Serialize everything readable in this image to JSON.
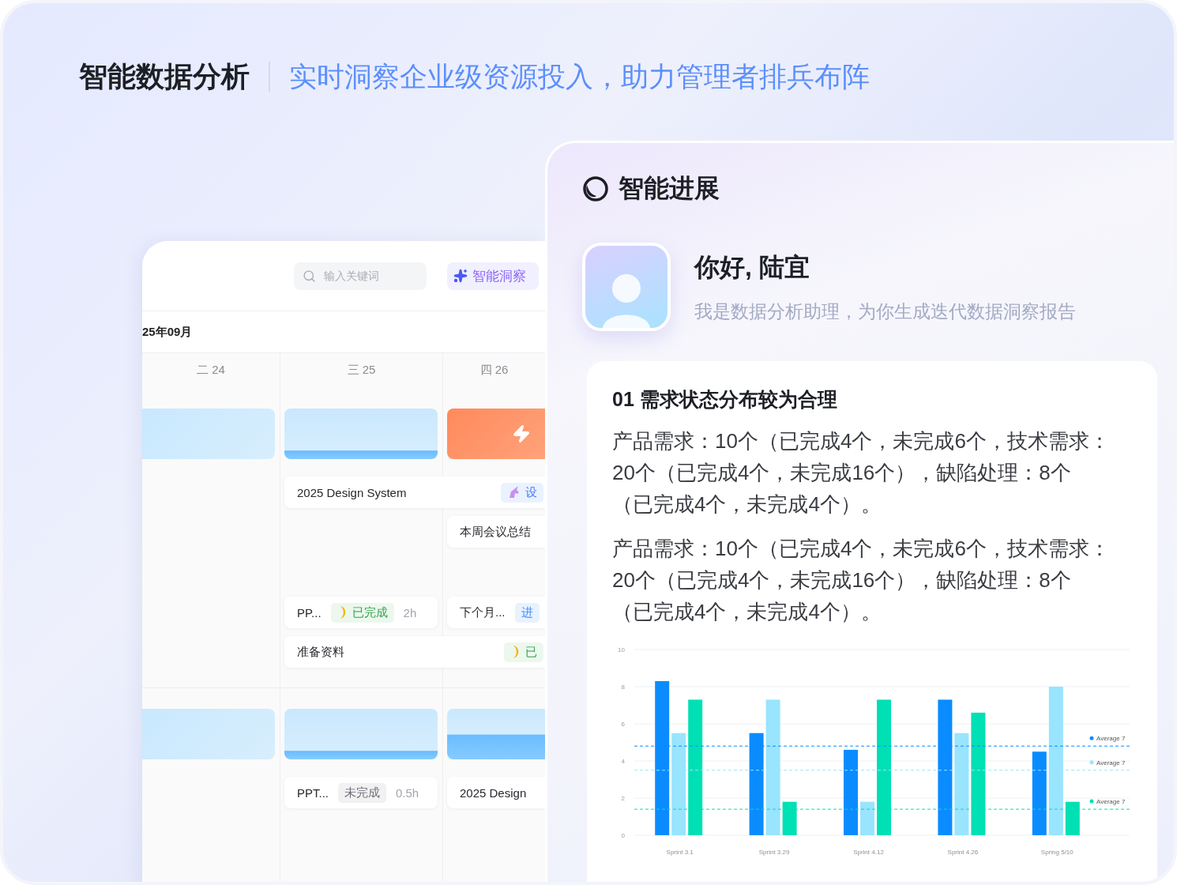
{
  "header": {
    "title": "智能数据分析",
    "subtitle": "实时洞察企业级资源投入，助力管理者排兵布阵"
  },
  "calendar": {
    "search": {
      "placeholder": "输入关键词"
    },
    "insight_button": "智能洞察",
    "month": "25年09月",
    "days": [
      "二 24",
      "三 25",
      "四 26"
    ],
    "weeks": [
      {
        "lanes": [
          [
            {
              "kind": "block"
            },
            {
              "kind": "block"
            },
            {
              "kind": "block"
            }
          ],
          [
            {
              "kind": "empty"
            },
            {
              "kind": "wide_task",
              "title": "2025 Design System",
              "tag": {
                "text": "设",
                "kind": "design"
              }
            }
          ],
          [
            {
              "kind": "empty"
            },
            {
              "kind": "empty"
            },
            {
              "kind": "task",
              "title": "本周会议总结"
            }
          ],
          [
            {
              "kind": "empty"
            },
            {
              "kind": "task",
              "title": "PP...",
              "tag": {
                "text": "已完成",
                "kind": "done"
              },
              "duration": "2h"
            },
            {
              "kind": "task",
              "title": "下个月...",
              "tag": {
                "text": "进",
                "kind": "progress"
              }
            }
          ],
          [
            {
              "kind": "empty"
            },
            {
              "kind": "wide_task",
              "title": "准备资料",
              "tag": {
                "text": "已",
                "kind": "done"
              }
            }
          ]
        ]
      },
      {
        "lanes": [
          [
            {
              "kind": "block"
            },
            {
              "kind": "block"
            },
            {
              "kind": "block"
            }
          ],
          [
            {
              "kind": "empty"
            },
            {
              "kind": "task",
              "title": "PPT...",
              "tag": {
                "text": "未完成",
                "kind": "todo"
              },
              "duration": "0.5h"
            },
            {
              "kind": "task",
              "title": "2025 Design"
            }
          ]
        ]
      }
    ]
  },
  "panel": {
    "title": "智能进展",
    "greeting": "你好, 陆宜",
    "intro": "我是数据分析助理，为你生成迭代数据洞察报告",
    "report": {
      "heading": "01 需求状态分布较为合理",
      "paragraphs": [
        "产品需求：10个（已完成4个，未完成6个，技术需求：20个（已完成4个，未完成16个），缺陷处理：8个（已完成4个，未完成4个）。",
        "产品需求：10个（已完成4个，未完成6个，技术需求：20个（已完成4个，未完成16个），缺陷处理：8个（已完成4个，未完成4个）。"
      ],
      "chart_data": {
        "type": "bar",
        "categories": [
          "Sprint 3.1",
          "Sprint 3.29",
          "Sprint 4.12",
          "Sprint 4.26",
          "Spring 5/10"
        ],
        "series": [
          {
            "color": "#0a8cff",
            "values": [
              8.3,
              5.5,
              4.6,
              7.3,
              4.5
            ]
          },
          {
            "color": "#99e4ff",
            "values": [
              5.5,
              7.3,
              1.8,
              5.5,
              8.0
            ]
          },
          {
            "color": "#00e0b5",
            "values": [
              7.3,
              1.8,
              7.3,
              6.6,
              1.8
            ]
          }
        ],
        "ylim": [
          0,
          10
        ],
        "yticks": [
          0,
          2,
          4,
          6,
          8,
          10
        ],
        "grid": true,
        "ref_lines": [
          {
            "axis": "y",
            "value": 4.8,
            "label": "Average 7",
            "color": "#0a8cff"
          },
          {
            "axis": "y",
            "value": 3.5,
            "label": "Average 7",
            "color": "#99e4ff"
          },
          {
            "axis": "y",
            "value": 1.4,
            "label": "Average 7",
            "color": "#00e0b5"
          }
        ]
      }
    }
  }
}
